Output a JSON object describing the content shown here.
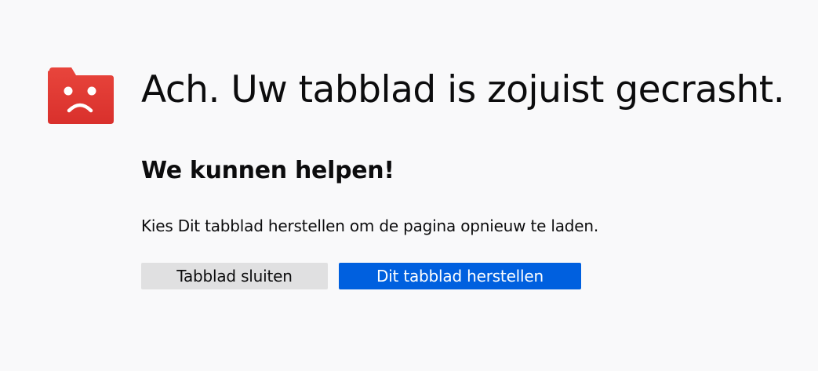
{
  "crash_page": {
    "icon": "sad-tab-folder-icon",
    "title": "Ach. Uw tabblad is zojuist gecrasht.",
    "subtitle": "We kunnen helpen!",
    "description": "Kies Dit tabblad herstellen om de pagina opnieuw te laden.",
    "close_button_label": "Tabblad sluiten",
    "restore_button_label": "Dit tabblad herstellen"
  },
  "colors": {
    "background": "#f9f9fa",
    "icon_red": "#e53935",
    "primary_button": "#0060df",
    "secondary_button": "#e0e0e1",
    "text": "#0c0c0d"
  }
}
